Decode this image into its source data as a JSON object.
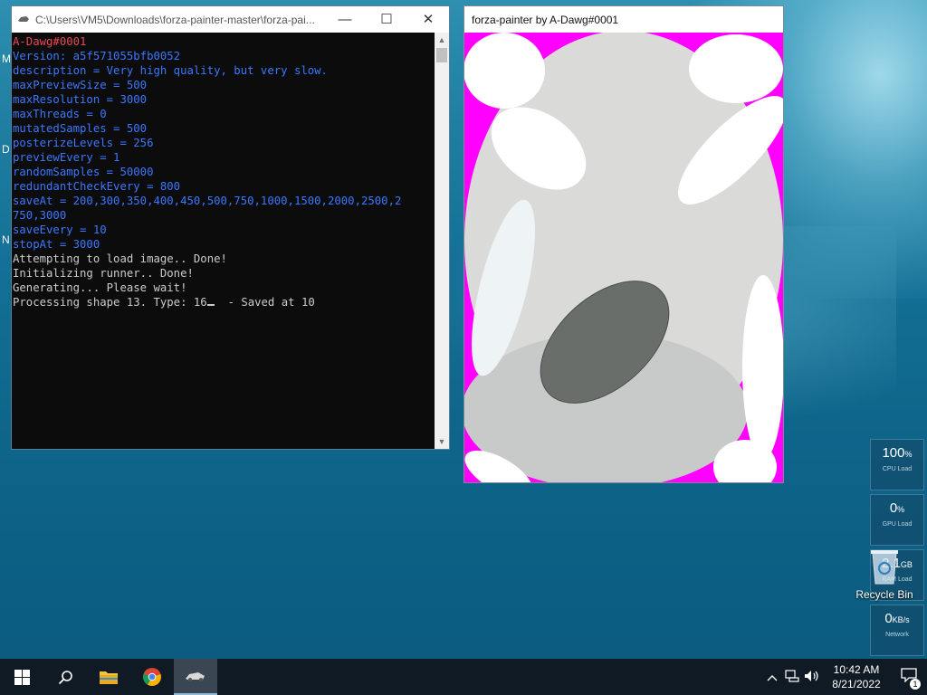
{
  "desktop": {
    "edge_letters": [
      "M",
      "D",
      "N"
    ]
  },
  "console": {
    "title": "C:\\Users\\VM5\\Downloads\\forza-painter-master\\forza-pai...",
    "lines": [
      {
        "text": "A-Dawg#0001",
        "color": "red"
      },
      {
        "text": "Version: a5f571055bfb0052",
        "color": "blue"
      },
      {
        "text": "description = Very high quality, but very slow.",
        "color": "blue"
      },
      {
        "text": "maxPreviewSize = 500",
        "color": "blue"
      },
      {
        "text": "maxResolution = 3000",
        "color": "blue"
      },
      {
        "text": "maxThreads = 0",
        "color": "blue"
      },
      {
        "text": "mutatedSamples = 500",
        "color": "blue"
      },
      {
        "text": "posterizeLevels = 256",
        "color": "blue"
      },
      {
        "text": "previewEvery = 1",
        "color": "blue"
      },
      {
        "text": "randomSamples = 50000",
        "color": "blue"
      },
      {
        "text": "redundantCheckEvery = 800",
        "color": "blue"
      },
      {
        "text": "saveAt = 200,300,350,400,450,500,750,1000,1500,2000,2500,2",
        "color": "blue"
      },
      {
        "text": "750,3000",
        "color": "blue"
      },
      {
        "text": "saveEvery = 10",
        "color": "blue"
      },
      {
        "text": "stopAt = 3000",
        "color": "blue"
      },
      {
        "text": "Attempting to load image.. Done!",
        "color": "white"
      },
      {
        "text": "Initializing runner.. Done!",
        "color": "white"
      },
      {
        "text": "Generating... Please wait!",
        "color": "white"
      }
    ],
    "progress_prefix": "Processing shape 13. Type: 16",
    "progress_suffix": "  - Saved at 10",
    "minimize_glyph": "—",
    "maximize_glyph": "☐",
    "close_glyph": "✕"
  },
  "painter": {
    "title": "forza-painter by A-Dawg#0001",
    "colors": {
      "background": "#ff00ff",
      "light": "#dadad8",
      "mid": "#c8cac9",
      "dark": "#6a6e6b",
      "white": "#ffffff",
      "pale": "#eef4f6"
    }
  },
  "gadgets": [
    {
      "value": "100",
      "unit": "%",
      "label": "CPU Load"
    },
    {
      "value": "0",
      "unit": "%",
      "label": "GPU Load"
    },
    {
      "value": "2.1",
      "unit": "GB",
      "label": "RAM Load"
    },
    {
      "value": "0",
      "unit": "KB/s",
      "label": "Network"
    }
  ],
  "recycle_bin": {
    "label": "Recycle Bin"
  },
  "taskbar": {
    "clock_time": "10:42 AM",
    "clock_date": "8/21/2022",
    "notification_count": "1"
  },
  "colors": {
    "console_red": "#e74856",
    "console_blue": "#3b78ff",
    "taskbar": "#101a24"
  }
}
